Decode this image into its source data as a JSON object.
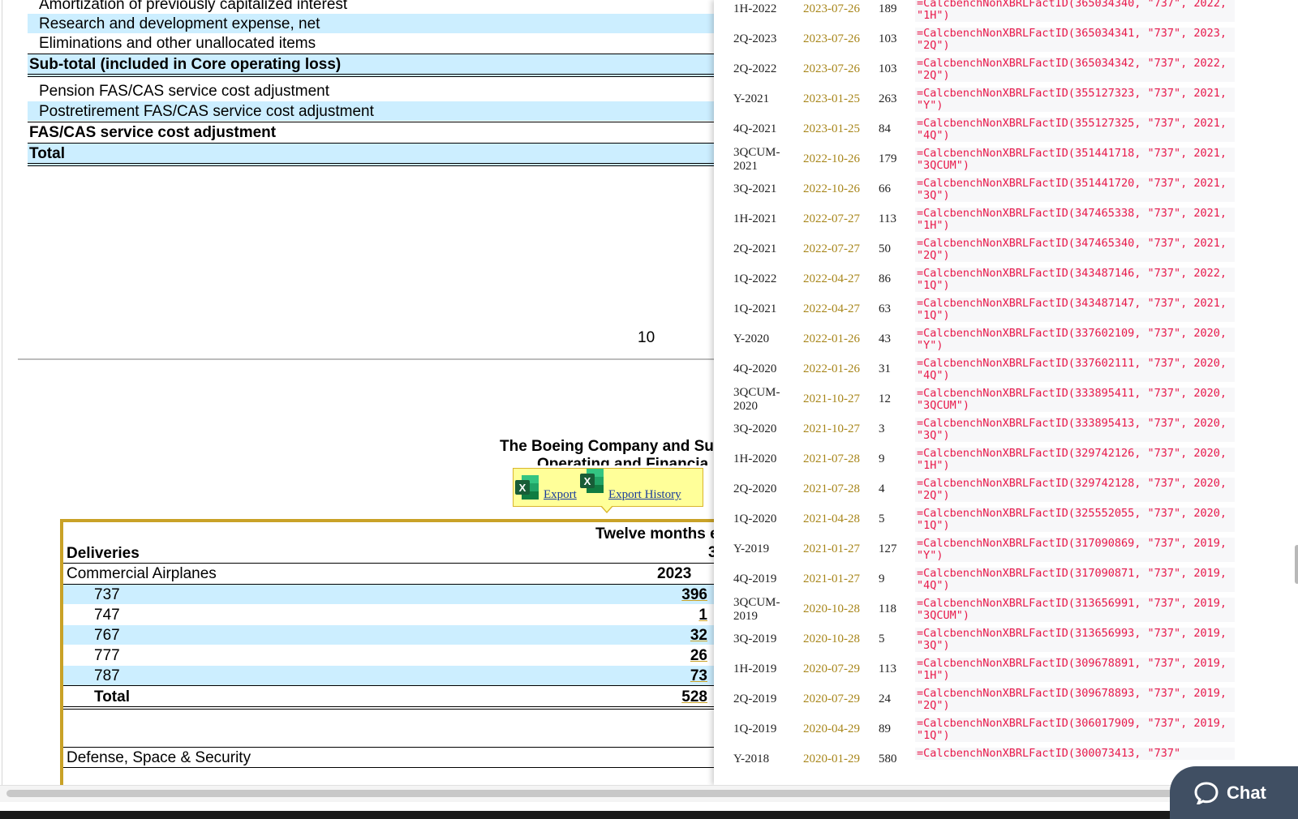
{
  "document": {
    "rows_top": [
      {
        "label": "Amortization of previously capitalized interest",
        "style": "plain indent"
      },
      {
        "label": "Research and development expense, net",
        "style": "hl indent"
      },
      {
        "label": "Eliminations and other unallocated items",
        "style": "plain indent"
      },
      {
        "label": "Sub-total (included in Core operating loss)",
        "style": "hl bold dbl"
      },
      {
        "label": "Pension FAS/CAS service cost adjustment",
        "style": "plain indent"
      },
      {
        "label": "Postretirement FAS/CAS service cost adjustment",
        "style": "hl indent"
      },
      {
        "label": "FAS/CAS service cost adjustment",
        "style": "plain bold sgl"
      },
      {
        "label": "Total",
        "style": "hl bold dbl"
      }
    ],
    "page_number": "10",
    "title_line1": "The Boeing Company and Su",
    "title_line2": "Operating and Financia",
    "export_popup": {
      "export_label": "Export",
      "history_label": "Export History"
    },
    "deliveries_table": {
      "header_twelve": "Twelve months e",
      "header_three": "3",
      "deliveries_label": "Deliveries",
      "segment_label": "Commercial Airplanes",
      "year": "2023",
      "rows": [
        {
          "label": "737",
          "value": "396"
        },
        {
          "label": "747",
          "value": "1"
        },
        {
          "label": "767",
          "value": "32"
        },
        {
          "label": "777",
          "value": "26"
        },
        {
          "label": "787",
          "value": "73"
        }
      ],
      "total_label": "Total",
      "total_value": "528",
      "next_segment_label": "Defense, Space & Security"
    }
  },
  "facts_panel": {
    "rows": [
      {
        "period": "1H-2022",
        "date": "2023-07-26",
        "value": "189",
        "formula": "=CalcbenchNonXBRLFactID(365034340, \"737\", 2022,\n\"1H\")"
      },
      {
        "period": "2Q-2023",
        "date": "2023-07-26",
        "value": "103",
        "formula": "=CalcbenchNonXBRLFactID(365034341, \"737\", 2023,\n\"2Q\")"
      },
      {
        "period": "2Q-2022",
        "date": "2023-07-26",
        "value": "103",
        "formula": "=CalcbenchNonXBRLFactID(365034342, \"737\", 2022,\n\"2Q\")"
      },
      {
        "period": "Y-2021",
        "date": "2023-01-25",
        "value": "263",
        "formula": "=CalcbenchNonXBRLFactID(355127323, \"737\", 2021,\n\"Y\")"
      },
      {
        "period": "4Q-2021",
        "date": "2023-01-25",
        "value": "84",
        "formula": "=CalcbenchNonXBRLFactID(355127325, \"737\", 2021,\n\"4Q\")"
      },
      {
        "period": "3QCUM-\n2021",
        "date": "2022-10-26",
        "value": "179",
        "formula": "=CalcbenchNonXBRLFactID(351441718, \"737\", 2021,\n\"3QCUM\")"
      },
      {
        "period": "3Q-2021",
        "date": "2022-10-26",
        "value": "66",
        "formula": "=CalcbenchNonXBRLFactID(351441720, \"737\", 2021,\n\"3Q\")"
      },
      {
        "period": "1H-2021",
        "date": "2022-07-27",
        "value": "113",
        "formula": "=CalcbenchNonXBRLFactID(347465338, \"737\", 2021,\n\"1H\")"
      },
      {
        "period": "2Q-2021",
        "date": "2022-07-27",
        "value": "50",
        "formula": "=CalcbenchNonXBRLFactID(347465340, \"737\", 2021,\n\"2Q\")"
      },
      {
        "period": "1Q-2022",
        "date": "2022-04-27",
        "value": "86",
        "formula": "=CalcbenchNonXBRLFactID(343487146, \"737\", 2022,\n\"1Q\")"
      },
      {
        "period": "1Q-2021",
        "date": "2022-04-27",
        "value": "63",
        "formula": "=CalcbenchNonXBRLFactID(343487147, \"737\", 2021,\n\"1Q\")"
      },
      {
        "period": "Y-2020",
        "date": "2022-01-26",
        "value": "43",
        "formula": "=CalcbenchNonXBRLFactID(337602109, \"737\", 2020,\n\"Y\")"
      },
      {
        "period": "4Q-2020",
        "date": "2022-01-26",
        "value": "31",
        "formula": "=CalcbenchNonXBRLFactID(337602111, \"737\", 2020,\n\"4Q\")"
      },
      {
        "period": "3QCUM-\n2020",
        "date": "2021-10-27",
        "value": "12",
        "formula": "=CalcbenchNonXBRLFactID(333895411, \"737\", 2020,\n\"3QCUM\")"
      },
      {
        "period": "3Q-2020",
        "date": "2021-10-27",
        "value": "3",
        "formula": "=CalcbenchNonXBRLFactID(333895413, \"737\", 2020,\n\"3Q\")"
      },
      {
        "period": "1H-2020",
        "date": "2021-07-28",
        "value": "9",
        "formula": "=CalcbenchNonXBRLFactID(329742126, \"737\", 2020,\n\"1H\")"
      },
      {
        "period": "2Q-2020",
        "date": "2021-07-28",
        "value": "4",
        "formula": "=CalcbenchNonXBRLFactID(329742128, \"737\", 2020,\n\"2Q\")"
      },
      {
        "period": "1Q-2020",
        "date": "2021-04-28",
        "value": "5",
        "formula": "=CalcbenchNonXBRLFactID(325552055, \"737\", 2020,\n\"1Q\")"
      },
      {
        "period": "Y-2019",
        "date": "2021-01-27",
        "value": "127",
        "formula": "=CalcbenchNonXBRLFactID(317090869, \"737\", 2019,\n\"Y\")"
      },
      {
        "period": "4Q-2019",
        "date": "2021-01-27",
        "value": "9",
        "formula": "=CalcbenchNonXBRLFactID(317090871, \"737\", 2019,\n\"4Q\")"
      },
      {
        "period": "3QCUM-\n2019",
        "date": "2020-10-28",
        "value": "118",
        "formula": "=CalcbenchNonXBRLFactID(313656991, \"737\", 2019,\n\"3QCUM\")"
      },
      {
        "period": "3Q-2019",
        "date": "2020-10-28",
        "value": "5",
        "formula": "=CalcbenchNonXBRLFactID(313656993, \"737\", 2019,\n\"3Q\")"
      },
      {
        "period": "1H-2019",
        "date": "2020-07-29",
        "value": "113",
        "formula": "=CalcbenchNonXBRLFactID(309678891, \"737\", 2019,\n\"1H\")"
      },
      {
        "period": "2Q-2019",
        "date": "2020-07-29",
        "value": "24",
        "formula": "=CalcbenchNonXBRLFactID(309678893, \"737\", 2019,\n\"2Q\")"
      },
      {
        "period": "1Q-2019",
        "date": "2020-04-29",
        "value": "89",
        "formula": "=CalcbenchNonXBRLFactID(306017909, \"737\", 2019,\n\"1Q\")"
      },
      {
        "period": "Y-2018",
        "date": "2020-01-29",
        "value": "580",
        "formula": "=CalcbenchNonXBRLFactID(300073413, \"737\""
      }
    ]
  },
  "chat_widget": {
    "label": "Chat"
  },
  "colors": {
    "highlight_row": "#cceeff",
    "gold_border": "#c9a227",
    "formula_text": "#e8194b",
    "date_text": "#a8861a",
    "chat_bg": "#404f63"
  }
}
